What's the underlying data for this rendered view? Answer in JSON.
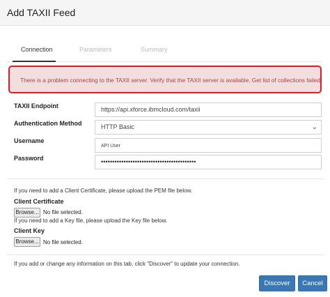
{
  "dialog": {
    "title": "Add TAXII Feed"
  },
  "tabs": [
    {
      "label": "Connection",
      "active": true
    },
    {
      "label": "Parameters",
      "active": false
    },
    {
      "label": "Summary",
      "active": false
    }
  ],
  "alert": {
    "message": "There is a problem connecting to the TAXII server. Verify that the TAXII server is available. Get list of collections failed."
  },
  "form": {
    "endpoint": {
      "label": "TAXII Endpoint",
      "value": "https://api.xforce.ibmcloud.com/taxii"
    },
    "auth": {
      "label": "Authentication Method",
      "value": "HTTP Basic"
    },
    "username": {
      "label": "Username",
      "value": "API User"
    },
    "password": {
      "label": "Password",
      "value": "••••••••••••••••••••••••••••••••••••••••••"
    }
  },
  "client_cert": {
    "note": "If you need to add a Client Certificate, please upload the PEM file below.",
    "label": "Client Certificate",
    "browse": "Browse...",
    "status": "No file selected."
  },
  "client_key": {
    "note": "If you need to add a Key file, please upload the Key file below.",
    "label": "Client Key",
    "browse": "Browse...",
    "status": "No file selected."
  },
  "footer": {
    "note": "If you add or change any information on this tab, click \"Discover\" to update your connection.",
    "discover": "Discover",
    "cancel": "Cancel"
  },
  "colors": {
    "primary": "#3a78b5",
    "alert_bg": "#f2dede",
    "alert_text": "#a94442",
    "highlight": "#d2222d"
  }
}
